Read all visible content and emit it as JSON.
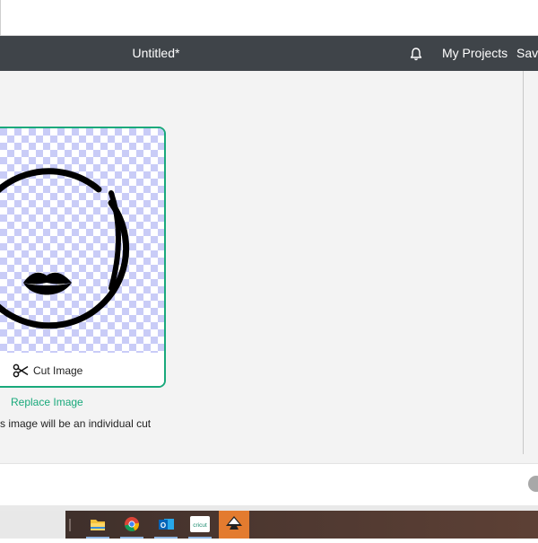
{
  "header": {
    "title": "Untitled*",
    "notifications_icon": "bell-icon",
    "my_projects_label": "My Projects",
    "save_label": "Save"
  },
  "image_card": {
    "cut_label": "Cut Image",
    "cut_icon": "scissors-icon",
    "replace_label": "Replace Image",
    "note": "s image will be an individual cut"
  },
  "colors": {
    "accent": "#19a97b",
    "header_bg": "#3f4449",
    "checker": "#c9ccf7"
  },
  "taskbar": {
    "apps": [
      {
        "name": "file-explorer-icon"
      },
      {
        "name": "chrome-icon"
      },
      {
        "name": "outlook-icon"
      },
      {
        "name": "cricut-icon",
        "label": "cricut"
      },
      {
        "name": "inkscape-icon"
      }
    ]
  }
}
